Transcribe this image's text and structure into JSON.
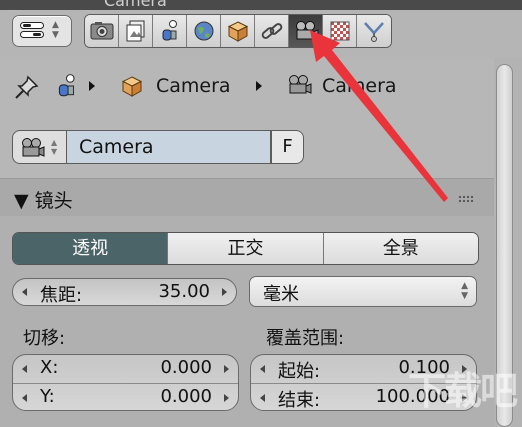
{
  "window": {
    "title_peek": "Camera"
  },
  "header": {
    "editor_type_icon": "properties-editor-icon",
    "tabs": [
      {
        "icon": "render-icon",
        "active": false
      },
      {
        "icon": "render-layers-icon",
        "active": false
      },
      {
        "icon": "scene-icon",
        "active": false
      },
      {
        "icon": "world-icon",
        "active": false
      },
      {
        "icon": "object-icon",
        "active": false
      },
      {
        "icon": "constraints-icon",
        "active": false
      },
      {
        "icon": "camera-data-icon",
        "active": true
      },
      {
        "icon": "texture-icon",
        "active": false
      },
      {
        "icon": "physics-icon",
        "active": false
      }
    ]
  },
  "breadcrumb": {
    "object": "Camera",
    "data": "Camera"
  },
  "datablock": {
    "name": "Camera",
    "fake_user": "F"
  },
  "lens": {
    "title": "▼ 镜头",
    "projection": [
      "透视",
      "正交",
      "全景"
    ],
    "focal_label": "焦距:",
    "focal_value": "35.00",
    "units": "毫米",
    "shift_label": "切移:",
    "shift_x_label": "X:",
    "shift_x_value": "0.000",
    "shift_y_label": "Y:",
    "shift_y_value": "0.000",
    "clip_label": "覆盖范围:",
    "clip_start_label": "起始:",
    "clip_start_value": "0.100",
    "clip_end_label": "结束:",
    "clip_end_value": "100.000"
  },
  "watermark": "下载吧",
  "colors": {
    "active_tab": "#3b3b3b",
    "projection_active": "#4a6467",
    "name_field": "#c8d5e0",
    "arrow": "#e8343a"
  }
}
